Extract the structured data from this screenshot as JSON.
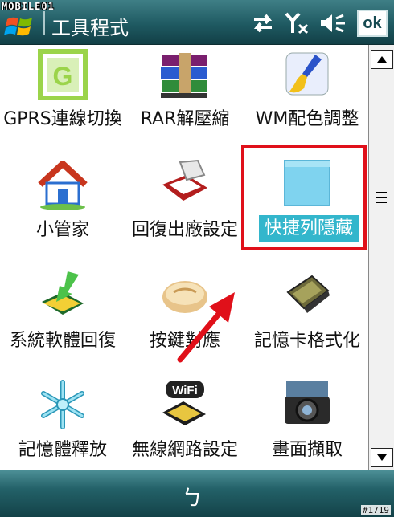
{
  "watermark": "MOBILE01",
  "titlebar": {
    "title": "工具程式",
    "ok_label": "ok"
  },
  "status_icons": [
    "sync-arrows-icon",
    "no-signal-icon",
    "speaker-muted-icon"
  ],
  "apps": [
    {
      "label": "GPRS連線切換",
      "icon": "gprs-g-icon"
    },
    {
      "label": "RAR解壓縮",
      "icon": "rar-books-icon"
    },
    {
      "label": "WM配色調整",
      "icon": "paint-brush-icon"
    },
    {
      "label": "小管家",
      "icon": "house-icon"
    },
    {
      "label": "回復出廠設定",
      "icon": "reset-device-icon"
    },
    {
      "label": "快捷列隱藏",
      "icon": "blue-panel-icon",
      "selected": true
    },
    {
      "label": "系統軟體回復",
      "icon": "install-arrow-icon"
    },
    {
      "label": "按鍵對應",
      "icon": "bread-icon"
    },
    {
      "label": "記憶卡格式化",
      "icon": "memory-card-icon"
    },
    {
      "label": "記憶體釋放",
      "icon": "snowflake-icon"
    },
    {
      "label": "無線網路設定",
      "icon": "wifi-device-icon"
    },
    {
      "label": "畫面擷取",
      "icon": "camera-icon"
    }
  ],
  "bottombar": {
    "keyboard_glyph": "ㄅ"
  },
  "photo_id": "#1719",
  "colors": {
    "selection": "#33b6cc",
    "annotation": "#e0101a",
    "bar": "#1f5a62"
  }
}
